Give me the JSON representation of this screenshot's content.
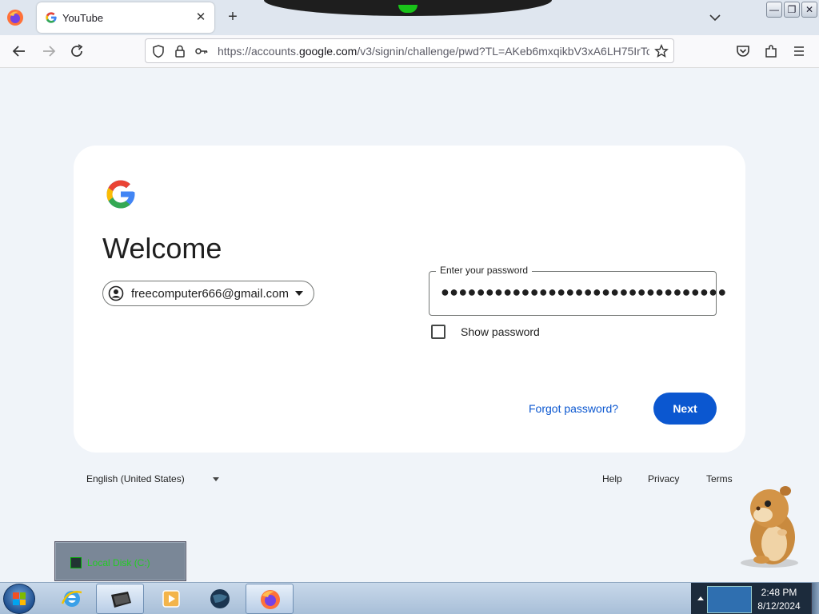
{
  "browser": {
    "tab": {
      "title": "YouTube",
      "close": "✕"
    },
    "new_tab": "+",
    "url": {
      "prefix": "https://accounts.",
      "domain": "google.com",
      "suffix": "/v3/signin/challenge/pwd?TL=AKeb6mxqikbV3xA6LH75IrTc"
    },
    "window_buttons": [
      "—",
      "❐",
      "✕"
    ]
  },
  "signin": {
    "heading": "Welcome",
    "account_email": "freecomputer666@gmail.com",
    "password_label": "Enter your password",
    "password_value": "●●●●●●●●●●●●●●●●●●●●●●●●●●●●●●●●",
    "show_password_label": "Show password",
    "show_password_checked": false,
    "forgot_password": "Forgot password?",
    "next_button": "Next"
  },
  "footer": {
    "language": "English (United States)",
    "help": "Help",
    "privacy": "Privacy",
    "terms": "Terms"
  },
  "desktop": {
    "local_disk_label": "Local Disk (C:)"
  },
  "taskbar": {
    "items": [
      "internet-explorer",
      "file-manager",
      "media-player",
      "globe",
      "firefox"
    ],
    "active_items": [
      "file-manager",
      "firefox"
    ],
    "clock_time": "2:48 PM",
    "clock_date": "8/12/2024"
  },
  "colors": {
    "accent": "#0b57d0",
    "page_background": "#f0f4f9",
    "card_background": "#ffffff"
  }
}
